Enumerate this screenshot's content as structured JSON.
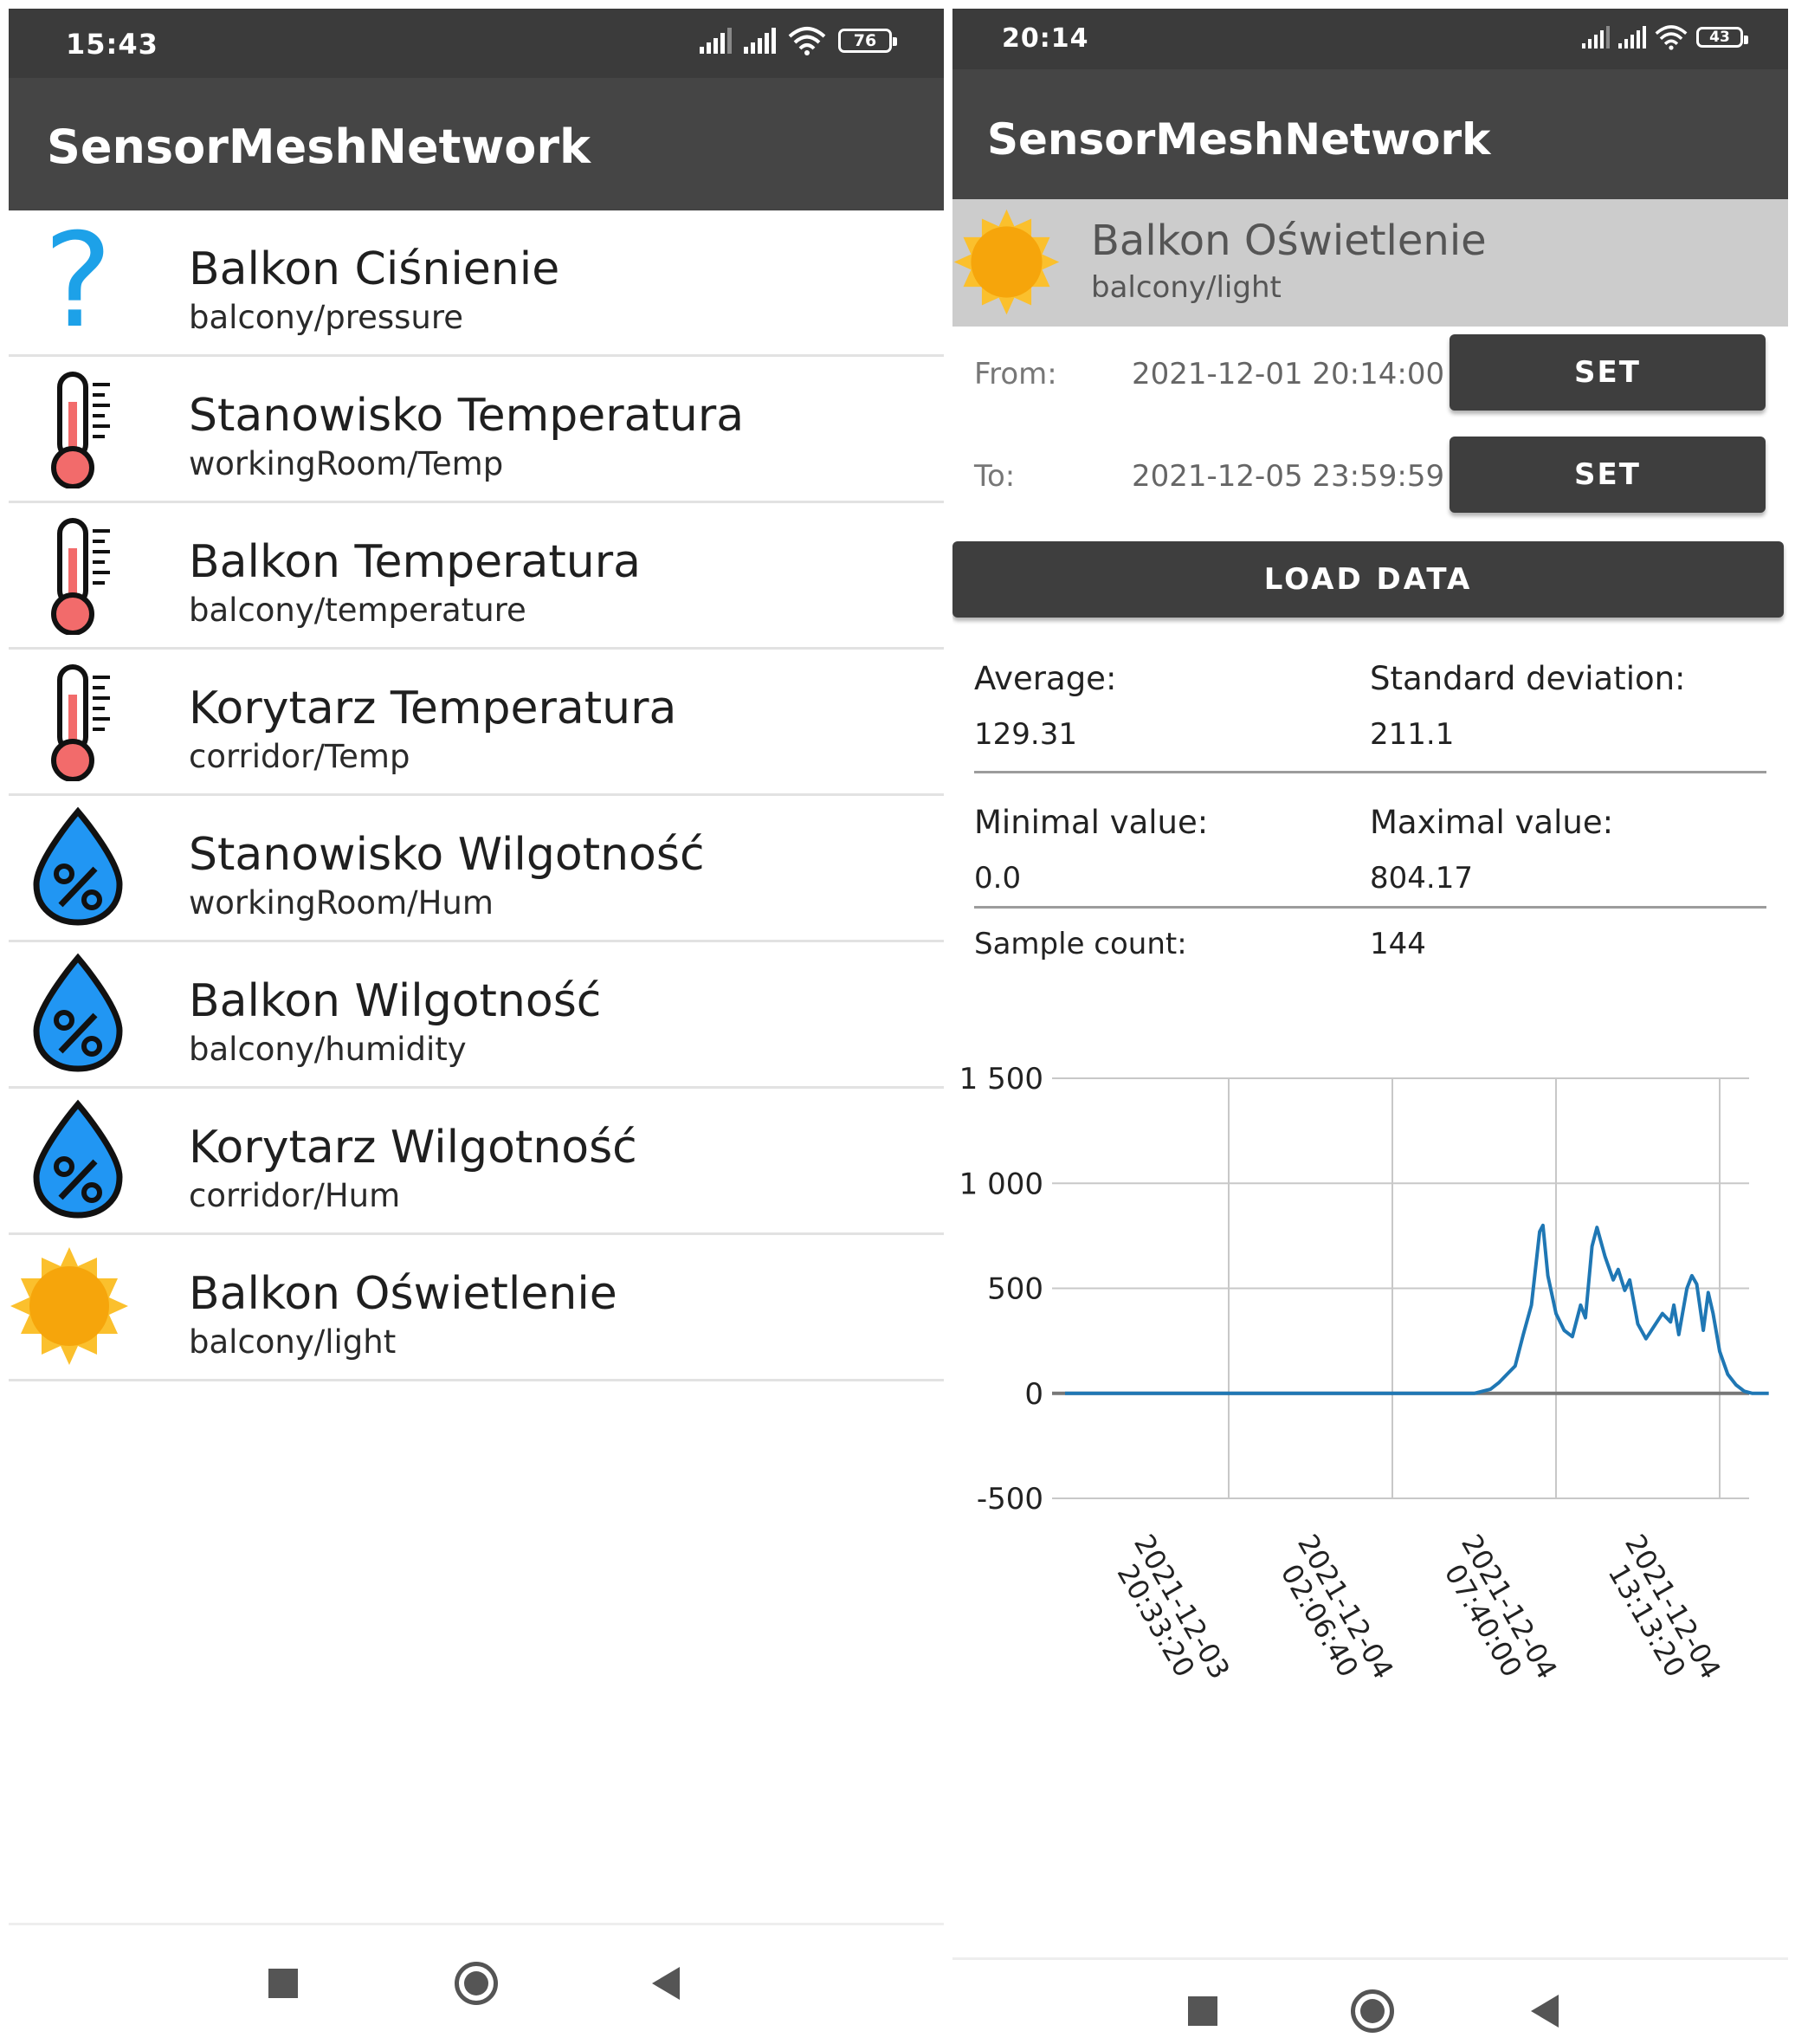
{
  "left": {
    "status": {
      "time": "15:43",
      "battery": "76"
    },
    "app_title": "SensorMeshNetwork",
    "sensors": [
      {
        "name": "Balkon Ciśnienie",
        "topic": "balcony/pressure",
        "icon": "question-icon"
      },
      {
        "name": "Stanowisko Temperatura",
        "topic": "workingRoom/Temp",
        "icon": "thermometer-icon"
      },
      {
        "name": "Balkon Temperatura",
        "topic": "balcony/temperature",
        "icon": "thermometer-icon"
      },
      {
        "name": "Korytarz Temperatura",
        "topic": "corridor/Temp",
        "icon": "thermometer-icon"
      },
      {
        "name": "Stanowisko Wilgotność",
        "topic": "workingRoom/Hum",
        "icon": "humidity-drop-icon"
      },
      {
        "name": "Balkon Wilgotność",
        "topic": "balcony/humidity",
        "icon": "humidity-drop-icon"
      },
      {
        "name": "Korytarz Wilgotność",
        "topic": "corridor/Hum",
        "icon": "humidity-drop-icon"
      },
      {
        "name": "Balkon Oświetlenie",
        "topic": "balcony/light",
        "icon": "sun-icon"
      }
    ]
  },
  "right": {
    "status": {
      "time": "20:14",
      "battery": "43"
    },
    "app_title": "SensorMeshNetwork",
    "selected": {
      "name": "Balkon Oświetlenie",
      "topic": "balcony/light",
      "icon": "sun-icon"
    },
    "from_label": "From:",
    "from_value": "2021-12-01 20:14:00",
    "to_label": "To:",
    "to_value": "2021-12-05 23:59:59",
    "set_label": "SET",
    "load_label": "LOAD DATA",
    "stats": {
      "average_label": "Average:",
      "average_value": "129.31",
      "stddev_label": "Standard deviation:",
      "stddev_value": "211.1",
      "min_label": "Minimal value:",
      "min_value": "0.0",
      "max_label": "Maximal value:",
      "max_value": "804.17",
      "count_label": "Sample count:",
      "count_value": "144"
    }
  },
  "colors": {
    "appbar": "#454545",
    "statusbar": "#3b3b3b",
    "line": "#1f77b4",
    "accent_blue": "#1da1e8",
    "sun": "#f6a50b"
  },
  "chart_data": {
    "type": "line",
    "ylim": [
      -500,
      1500
    ],
    "yticks": [
      -500,
      0,
      500,
      1000,
      1500
    ],
    "ytick_labels": [
      "-500",
      "0",
      "500",
      "1 000",
      "1 500"
    ],
    "xtick_labels": [
      [
        "2021-12-03",
        "20:33:20"
      ],
      [
        "2021-12-04",
        "02:06:40"
      ],
      [
        "2021-12-04",
        "07:40:00"
      ],
      [
        "2021-12-04",
        "13:13:20"
      ]
    ],
    "grid": true,
    "series": [
      {
        "points": [
          [
            0.0,
            0
          ],
          [
            1.0,
            0
          ],
          [
            1.5,
            0
          ],
          [
            2.0,
            0
          ],
          [
            2.5,
            0
          ],
          [
            2.6,
            20
          ],
          [
            2.65,
            50
          ],
          [
            2.7,
            90
          ],
          [
            2.75,
            130
          ],
          [
            2.8,
            280
          ],
          [
            2.85,
            420
          ],
          [
            2.9,
            770
          ],
          [
            2.92,
            800
          ],
          [
            2.95,
            560
          ],
          [
            3.0,
            380
          ],
          [
            3.05,
            300
          ],
          [
            3.1,
            270
          ],
          [
            3.15,
            420
          ],
          [
            3.18,
            360
          ],
          [
            3.22,
            700
          ],
          [
            3.25,
            790
          ],
          [
            3.3,
            650
          ],
          [
            3.35,
            540
          ],
          [
            3.38,
            590
          ],
          [
            3.42,
            490
          ],
          [
            3.45,
            540
          ],
          [
            3.5,
            330
          ],
          [
            3.55,
            260
          ],
          [
            3.6,
            320
          ],
          [
            3.65,
            380
          ],
          [
            3.7,
            340
          ],
          [
            3.72,
            420
          ],
          [
            3.75,
            280
          ],
          [
            3.8,
            500
          ],
          [
            3.83,
            560
          ],
          [
            3.86,
            520
          ],
          [
            3.9,
            300
          ],
          [
            3.93,
            480
          ],
          [
            3.96,
            380
          ],
          [
            4.0,
            200
          ],
          [
            4.05,
            90
          ],
          [
            4.1,
            40
          ],
          [
            4.15,
            10
          ],
          [
            4.2,
            0
          ],
          [
            4.3,
            0
          ]
        ]
      }
    ]
  }
}
